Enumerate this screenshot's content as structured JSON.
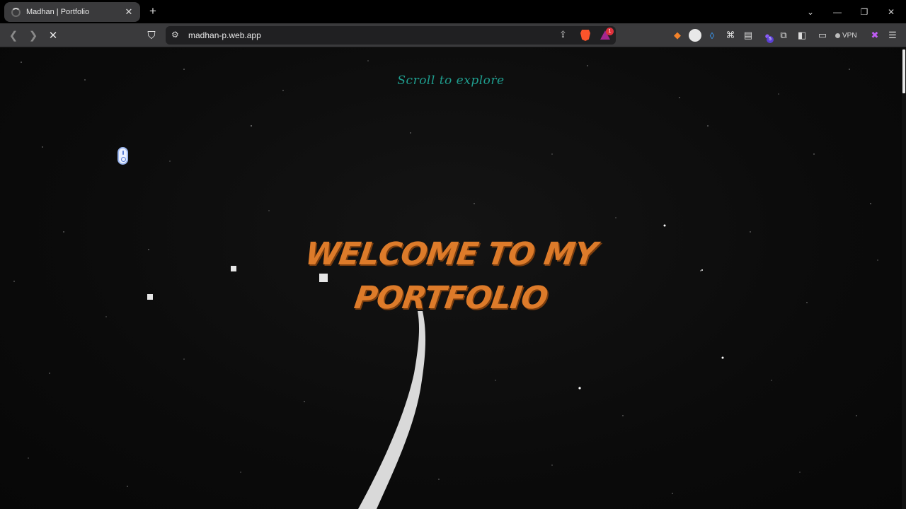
{
  "browser": {
    "tab_title": "Madhan | Portfolio",
    "new_tab": "+",
    "url": "madhan-p.web.app",
    "rewards_count": "1",
    "extension_badge": "5",
    "vpn_label": "VPN"
  },
  "page": {
    "scroll_hint": "Scroll to explore",
    "headline_line1": "WELCOME TO MY",
    "headline_line2": "PORTFOLIO"
  },
  "colors": {
    "headline": "#dd7b2a",
    "scroll_hint": "#1f9e8f",
    "background": "#0a0a0a"
  }
}
